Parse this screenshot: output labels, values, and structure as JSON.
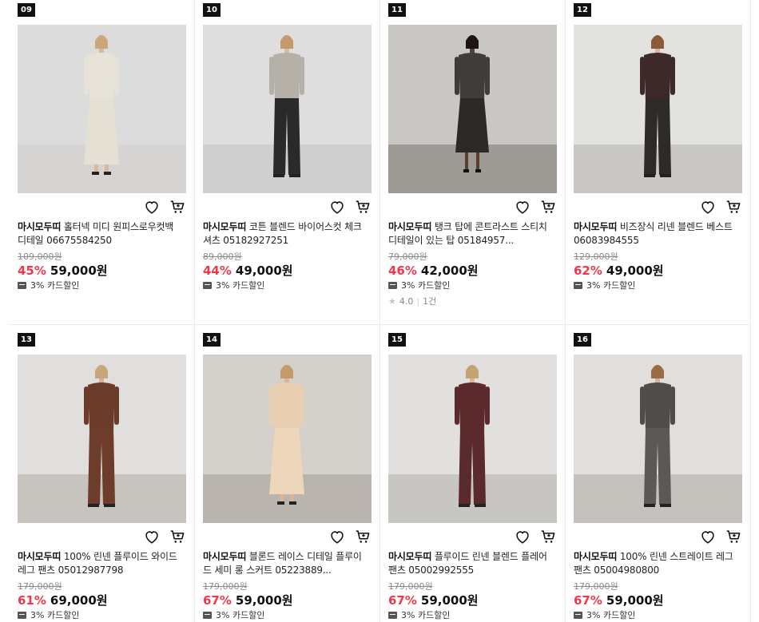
{
  "currency_note": "원",
  "products": [
    {
      "rank": "09",
      "brand": "마시모두띠",
      "name": "홀터넥 미디 원피스로우컷백 디테일 06675584250",
      "original_price": "109,000원",
      "discount": "45%",
      "price": "59,000원",
      "card_promo": "3% 카드할인",
      "rating": null,
      "review_count": null,
      "photo": {
        "bg": "#dcdcdc",
        "floor": "#d5d4d2",
        "top": "#e8e3d8",
        "bottom": "#e5e0d4",
        "skin": "#d9b8a0",
        "hair": "#c9a77a",
        "style": "dress"
      }
    },
    {
      "rank": "10",
      "brand": "마시모두띠",
      "name": "코튼 블렌드 바이어스컷 체크 셔츠 05182927251",
      "original_price": "89,000원",
      "discount": "44%",
      "price": "49,000원",
      "card_promo": "3% 카드할인",
      "rating": null,
      "review_count": null,
      "photo": {
        "bg": "#dedede",
        "floor": "#cfcfcf",
        "top": "#b5b0a8",
        "bottom": "#2a2a2a",
        "skin": "#dab9a1",
        "hair": "#c39a6b",
        "style": "pants"
      }
    },
    {
      "rank": "11",
      "brand": "마시모두띠",
      "name": "탱크 탑에 콘트라스트 스티치 디테일이 있는 탑 05184957...",
      "original_price": "79,000원",
      "discount": "46%",
      "price": "42,000원",
      "card_promo": "3% 카드할인",
      "rating": "4.0",
      "review_count": "1건",
      "photo": {
        "bg": "#c9c7c3",
        "floor": "#9e9a95",
        "top": "#3f3d3a",
        "bottom": "#2b2a28",
        "skin": "#5a3e2f",
        "hair": "#1b1612",
        "style": "skirt"
      }
    },
    {
      "rank": "12",
      "brand": "마시모두띠",
      "name": "비즈장식 리넨 블렌드 베스트 06083984555",
      "original_price": "129,000원",
      "discount": "62%",
      "price": "49,000원",
      "card_promo": "3% 카드할인",
      "rating": null,
      "review_count": null,
      "photo": {
        "bg": "#e2e2e0",
        "floor": "#cac8c4",
        "top": "#3d2a28",
        "bottom": "#2e2a28",
        "skin": "#d7b49b",
        "hair": "#8b5a3a",
        "style": "pants"
      }
    },
    {
      "rank": "13",
      "brand": "마시모두띠",
      "name": "100% 린넨 플루이드 와이드 레그 팬츠 05012987798",
      "original_price": "179,000원",
      "discount": "61%",
      "price": "69,000원",
      "card_promo": "3% 카드할인",
      "rating": null,
      "review_count": null,
      "photo": {
        "bg": "#e0dfdd",
        "floor": "#c7c4c0",
        "top": "#6b3b29",
        "bottom": "#6e3c2a",
        "skin": "#d3b096",
        "hair": "#c8a57a",
        "style": "pants"
      }
    },
    {
      "rank": "14",
      "brand": "마시모두띠",
      "name": "블론드 레이스 디테일 플루이드 세미 롱 스커트 05223889...",
      "original_price": "179,000원",
      "discount": "67%",
      "price": "59,000원",
      "card_promo": "3% 카드할인",
      "rating": null,
      "review_count": null,
      "photo": {
        "bg": "#d4d1cc",
        "floor": "#b9b4ad",
        "top": "#e9cfb1",
        "bottom": "#edd6ba",
        "skin": "#d8b49a",
        "hair": "#c49c6c",
        "style": "dress"
      }
    },
    {
      "rank": "15",
      "brand": "마시모두띠",
      "name": "플루이드 린넨 블렌드 플레어 팬츠 05002992555",
      "original_price": "179,000원",
      "discount": "67%",
      "price": "59,000원",
      "card_promo": "3% 카드할인",
      "rating": null,
      "review_count": null,
      "photo": {
        "bg": "#e1e0de",
        "floor": "#c8c6c2",
        "top": "#5b2a2c",
        "bottom": "#5a2a2d",
        "skin": "#d8b69d",
        "hair": "#c5a272",
        "style": "pants"
      }
    },
    {
      "rank": "16",
      "brand": "마시모두띠",
      "name": "100% 린넨 스트레이트 레그 팬츠 05004980800",
      "original_price": "179,000원",
      "discount": "67%",
      "price": "59,000원",
      "card_promo": "3% 카드할인",
      "rating": null,
      "review_count": null,
      "photo": {
        "bg": "#e0dfdc",
        "floor": "#c5c2be",
        "top": "#4e4d4a",
        "bottom": "#5a5955",
        "skin": "#d6b39a",
        "hair": "#9a6b45",
        "style": "pants"
      }
    }
  ]
}
